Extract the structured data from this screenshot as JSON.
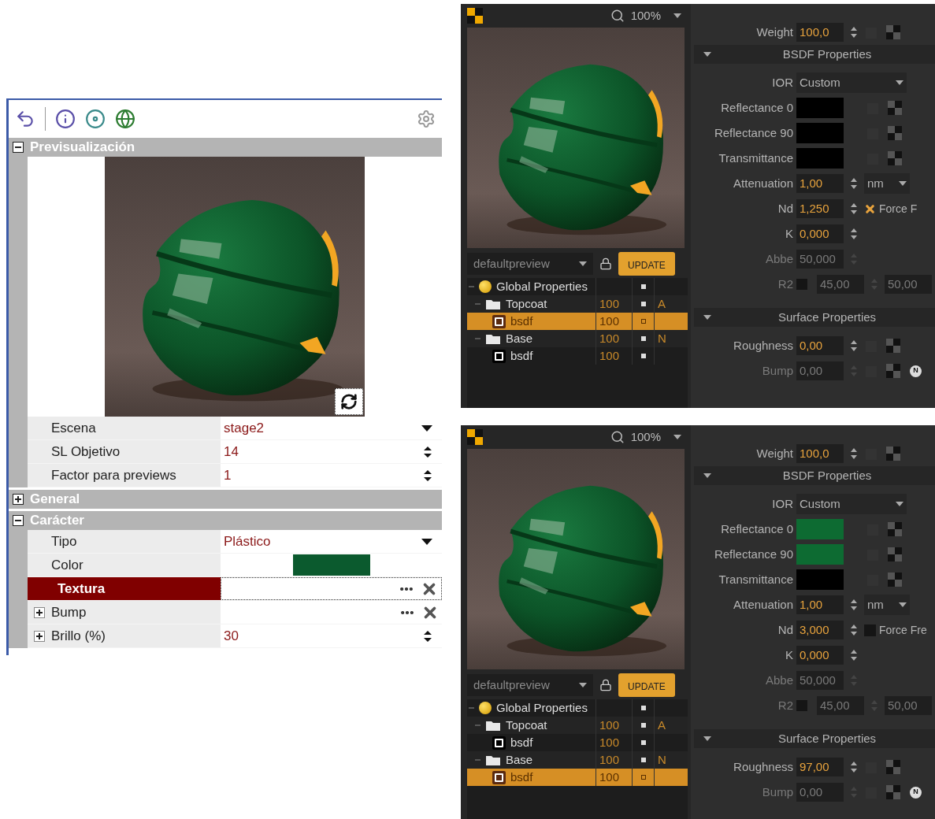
{
  "properties_panel": {
    "sections": [
      {
        "title": "Previsualización",
        "expanded": true,
        "kind": "preview",
        "rows": [
          {
            "label": "Escena",
            "value": "stage2",
            "kind": "dropdown",
            "expandable": false,
            "selected": false
          },
          {
            "label": "SL Objetivo",
            "value": "14",
            "kind": "spinner",
            "expandable": false,
            "selected": false
          },
          {
            "label": "Factor para previews",
            "value": "1",
            "kind": "spinner",
            "expandable": false,
            "selected": false
          }
        ]
      },
      {
        "title": "General",
        "expanded": false
      },
      {
        "title": "Carácter",
        "expanded": true,
        "kind": "group",
        "rows": [
          {
            "label": "Tipo",
            "value": "Plástico",
            "kind": "dropdown",
            "expandable": false,
            "selected": false
          },
          {
            "label": "Color",
            "kind": "color",
            "color": "#0b5a2e",
            "expandable": false,
            "selected": false
          },
          {
            "label": "Textura",
            "kind": "texture",
            "expandable": false,
            "selected": true
          },
          {
            "label": "Bump",
            "kind": "texture",
            "expandable": true,
            "selected": false
          },
          {
            "label": "Brillo (%)",
            "value": "30",
            "kind": "spinner",
            "expandable": true,
            "selected": false
          }
        ]
      }
    ]
  },
  "material_editors": [
    {
      "zoom": "100%",
      "preset": "defaultpreview",
      "update_label": "UPDATE",
      "layers": [
        {
          "name": "Global Properties",
          "kind": "global",
          "selected": false,
          "expanded": true,
          "children": [
            {
              "name": "Topcoat",
              "kind": "layer",
              "weight": "100",
              "tag": "A",
              "selected": false,
              "expanded": true,
              "children": [
                {
                  "name": "bsdf",
                  "kind": "bsdf",
                  "weight": "100",
                  "selected": true
                }
              ]
            },
            {
              "name": "Base",
              "kind": "layer",
              "weight": "100",
              "tag": "N",
              "selected": false,
              "expanded": true,
              "children": [
                {
                  "name": "bsdf",
                  "kind": "bsdf",
                  "weight": "100",
                  "selected": false
                }
              ]
            }
          ]
        }
      ],
      "weight": {
        "label": "Weight",
        "kind": "number",
        "value": "100,0",
        "disabled": false,
        "texture_slot": true
      },
      "sections": [
        {
          "title": "BSDF Properties",
          "expanded": true,
          "rows": [
            {
              "label": "IOR",
              "kind": "dropdown",
              "value": "Custom",
              "disabled": false,
              "texture_slot": false
            },
            {
              "label": "Reflectance 0",
              "kind": "color",
              "color": "#000000",
              "disabled": false,
              "texture_slot": true
            },
            {
              "label": "Reflectance 90",
              "kind": "color",
              "color": "#000000",
              "disabled": false,
              "texture_slot": true
            },
            {
              "label": "Transmittance",
              "kind": "color",
              "color": "#000000",
              "disabled": false,
              "texture_slot": true
            },
            {
              "label": "Attenuation",
              "kind": "number",
              "value": "1,00",
              "unit": "nm",
              "disabled": false,
              "texture_slot": false
            },
            {
              "label": "Nd",
              "kind": "number",
              "value": "1,250",
              "check": {
                "label": "Force F",
                "checked": true
              },
              "disabled": false,
              "texture_slot": false
            },
            {
              "label": "K",
              "kind": "number",
              "value": "0,000",
              "disabled": false,
              "texture_slot": false
            },
            {
              "label": "Abbe",
              "kind": "number",
              "value": "50,000",
              "disabled": true,
              "texture_slot": false
            },
            {
              "label": "R2",
              "kind": "pair",
              "checked": false,
              "values": [
                "45,00",
                "50,00"
              ],
              "disabled": true,
              "texture_slot": false
            }
          ]
        },
        {
          "title": "Surface Properties",
          "expanded": true,
          "rows": [
            {
              "label": "Roughness",
              "kind": "number",
              "value": "0,00",
              "disabled": false,
              "texture_slot": true
            },
            {
              "label": "Bump",
              "kind": "number",
              "value": "0,00",
              "disabled": true,
              "texture_slot": true,
              "badge": "N"
            }
          ]
        }
      ]
    },
    {
      "zoom": "100%",
      "preset": "defaultpreview",
      "update_label": "UPDATE",
      "layers": [
        {
          "name": "Global Properties",
          "kind": "global",
          "selected": false,
          "expanded": true,
          "children": [
            {
              "name": "Topcoat",
              "kind": "layer",
              "weight": "100",
              "tag": "A",
              "selected": false,
              "expanded": true,
              "children": [
                {
                  "name": "bsdf",
                  "kind": "bsdf",
                  "weight": "100",
                  "selected": false
                }
              ]
            },
            {
              "name": "Base",
              "kind": "layer",
              "weight": "100",
              "tag": "N",
              "selected": false,
              "expanded": true,
              "children": [
                {
                  "name": "bsdf",
                  "kind": "bsdf",
                  "weight": "100",
                  "selected": true
                }
              ]
            }
          ]
        }
      ],
      "weight": {
        "label": "Weight",
        "kind": "number",
        "value": "100,0",
        "disabled": false,
        "texture_slot": true
      },
      "sections": [
        {
          "title": "BSDF Properties",
          "expanded": true,
          "rows": [
            {
              "label": "IOR",
              "kind": "dropdown",
              "value": "Custom",
              "disabled": false,
              "texture_slot": false
            },
            {
              "label": "Reflectance 0",
              "kind": "color",
              "color": "#0d6b32",
              "disabled": false,
              "texture_slot": true
            },
            {
              "label": "Reflectance 90",
              "kind": "color",
              "color": "#0d6b32",
              "disabled": false,
              "texture_slot": true
            },
            {
              "label": "Transmittance",
              "kind": "color",
              "color": "#000000",
              "disabled": false,
              "texture_slot": true
            },
            {
              "label": "Attenuation",
              "kind": "number",
              "value": "1,00",
              "unit": "nm",
              "disabled": false,
              "texture_slot": false
            },
            {
              "label": "Nd",
              "kind": "number",
              "value": "3,000",
              "check": {
                "label": "Force Fre",
                "checked": false
              },
              "disabled": false,
              "texture_slot": false
            },
            {
              "label": "K",
              "kind": "number",
              "value": "0,000",
              "disabled": false,
              "texture_slot": false
            },
            {
              "label": "Abbe",
              "kind": "number",
              "value": "50,000",
              "disabled": true,
              "texture_slot": false
            },
            {
              "label": "R2",
              "kind": "pair",
              "checked": false,
              "values": [
                "45,00",
                "50,00"
              ],
              "disabled": true,
              "texture_slot": false
            }
          ]
        },
        {
          "title": "Surface Properties",
          "expanded": true,
          "rows": [
            {
              "label": "Roughness",
              "kind": "number",
              "value": "97,00",
              "disabled": false,
              "texture_slot": true
            },
            {
              "label": "Bump",
              "kind": "number",
              "value": "0,00",
              "disabled": true,
              "texture_slot": true,
              "badge": "N"
            }
          ]
        }
      ]
    }
  ]
}
